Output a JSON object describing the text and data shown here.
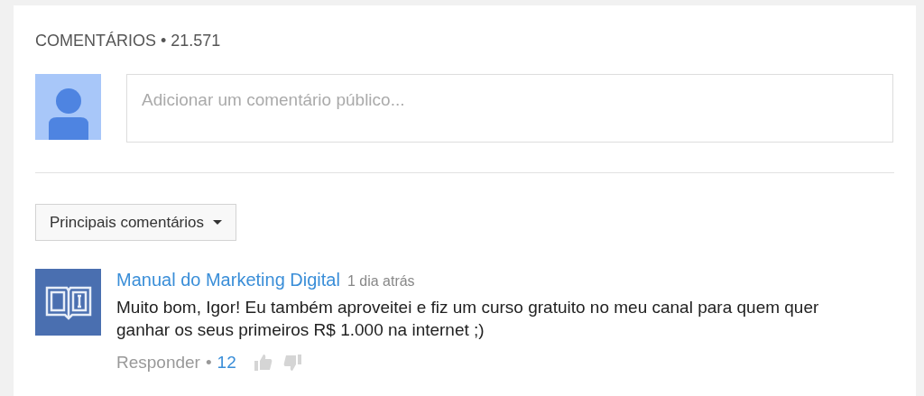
{
  "header": {
    "title": "COMENTÁRIOS",
    "separator": "•",
    "count": "21.571"
  },
  "composer": {
    "placeholder": "Adicionar um comentário público..."
  },
  "sort": {
    "label": "Principais comentários"
  },
  "comments": [
    {
      "author": "Manual do Marketing Digital",
      "time": "1 dia atrás",
      "text": "Muito bom, Igor! Eu também aproveitei e fiz um curso gratuito no meu canal para quem quer ganhar os seus primeiros R$ 1.000 na internet ;)",
      "reply": "Responder",
      "separator": "•",
      "likes": "12"
    }
  ]
}
